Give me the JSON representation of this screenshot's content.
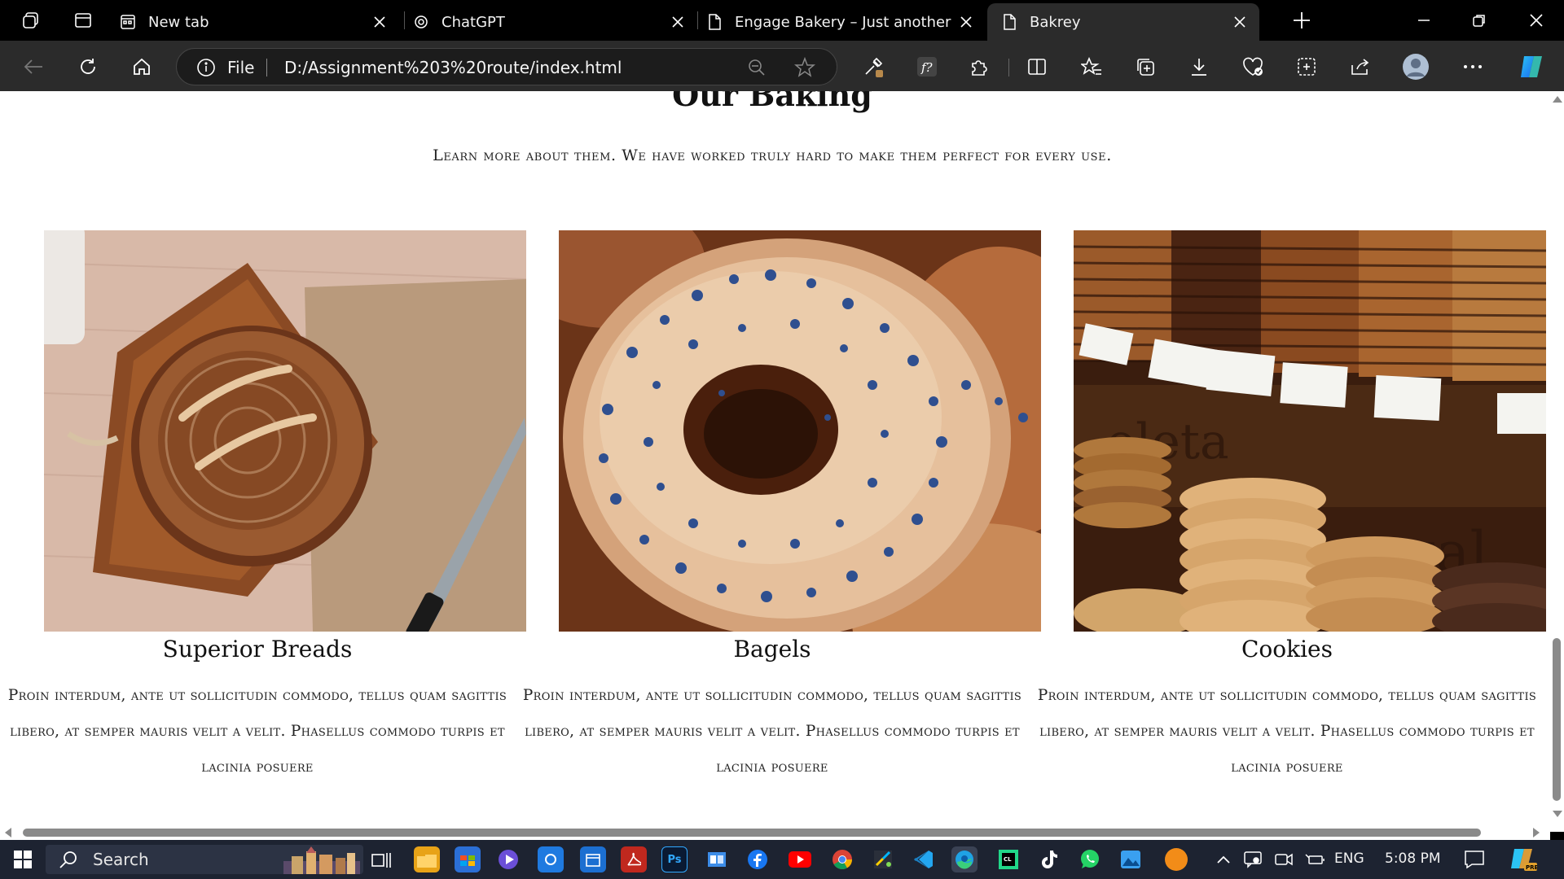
{
  "browser": {
    "tabs": [
      {
        "title": "New tab"
      },
      {
        "title": "ChatGPT"
      },
      {
        "title": "Engage Bakery – Just another Eng"
      },
      {
        "title": "Bakrey"
      }
    ],
    "address": {
      "scheme_label": "File",
      "url": "D:/Assignment%203%20route/index.html"
    }
  },
  "page": {
    "heading": "Our Baking",
    "subheading": "Learn more about them. We have worked truly hard to make them perfect for every use.",
    "cards": [
      {
        "title": "Superior Breads",
        "description": "Proin interdum, ante ut sollicitudin commodo, tellus quam sagittis libero, at semper mauris velit a velit. Phasellus commodo turpis et lacinia posuere",
        "image": "sourdough-loaf-on-board"
      },
      {
        "title": "Bagels",
        "description": "Proin interdum, ante ut sollicitudin commodo, tellus quam sagittis libero, at semper mauris velit a velit. Phasellus commodo turpis et lacinia posuere",
        "image": "poppy-seed-bagel"
      },
      {
        "title": "Cookies",
        "description": "Proin interdum, ante ut sollicitudin commodo, tellus quam sagittis libero, at semper mauris velit a velit. Phasellus commodo turpis et lacinia posuere",
        "image": "stacked-cookies-display"
      }
    ]
  },
  "taskbar": {
    "search_label": "Search",
    "language": "ENG",
    "time": "5:08 PM"
  },
  "colors": {
    "tabstrip_bg": "#000000",
    "toolbar_bg": "#2b2b2b",
    "page_bg": "#ffffff",
    "taskbar_bg": "#1d2331"
  }
}
